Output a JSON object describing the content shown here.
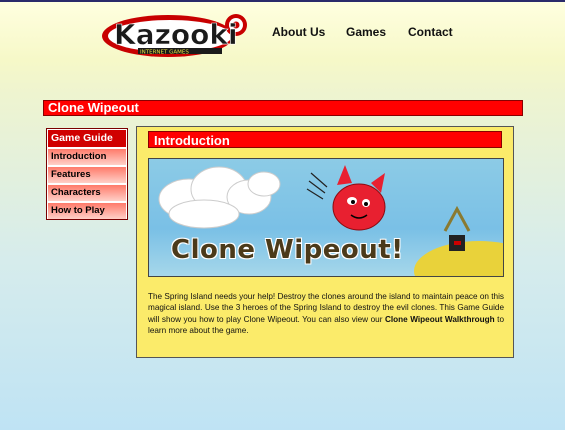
{
  "logo": {
    "text": "Kazooki",
    "tagline": "INTERNET GAMES"
  },
  "nav": {
    "about": "About Us",
    "games": "Games",
    "contact": "Contact"
  },
  "page": {
    "title": "Clone Wipeout"
  },
  "sidebar": {
    "items": [
      {
        "label": "Game Guide",
        "active": true
      },
      {
        "label": "Introduction"
      },
      {
        "label": "Features"
      },
      {
        "label": "Characters"
      },
      {
        "label": "How to Play"
      }
    ]
  },
  "main": {
    "section_title": "Introduction",
    "banner_title": "Clone Wipeout!",
    "intro_before_link": "The Spring Island needs your help! Destroy the clones around the island to maintain peace on this magical island. Use the 3 heroes of the Spring Island to destroy the evil clones. This Game Guide will show you how to play Clone Wipeout. You can also view our ",
    "intro_link": "Clone Wipeout Walkthrough",
    "intro_after_link": " to learn more about the game."
  },
  "colors": {
    "accent_red": "#ff0000",
    "panel_yellow": "#fbeb6a"
  }
}
